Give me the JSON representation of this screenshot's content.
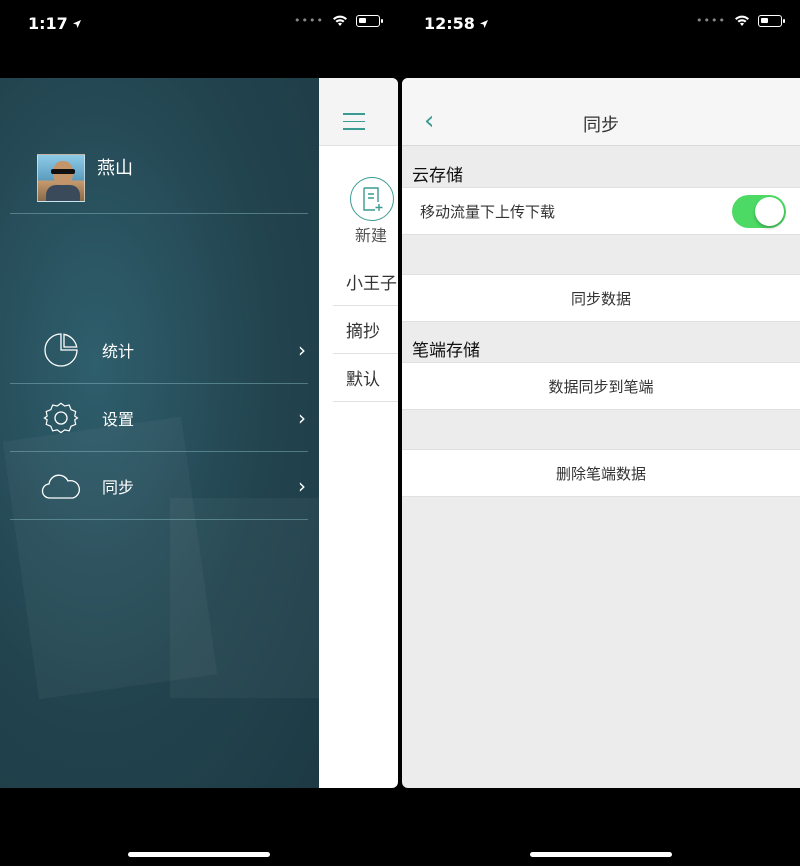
{
  "left": {
    "status": {
      "time": "1:17"
    },
    "drawer": {
      "username": "燕山",
      "menu": [
        {
          "label": "统计",
          "icon": "pie-chart-icon"
        },
        {
          "label": "设置",
          "icon": "gear-icon"
        },
        {
          "label": "同步",
          "icon": "cloud-icon"
        }
      ]
    },
    "peek": {
      "new_label": "新建",
      "rows": [
        "小王子",
        "摘抄",
        "默认"
      ]
    }
  },
  "right": {
    "status": {
      "time": "12:58"
    },
    "nav": {
      "title": "同步"
    },
    "cloud_section": {
      "header": "云存储",
      "toggle_label": "移动流量下上传下载",
      "toggle_on": true,
      "sync_button": "同步数据"
    },
    "pen_section": {
      "header": "笔端存储",
      "sync_to_pen": "数据同步到笔端",
      "delete_pen_data": "删除笔端数据"
    }
  },
  "colors": {
    "accent": "#3a9b92",
    "toggle_on": "#4cd964",
    "drawer_bg": "#22444f"
  }
}
